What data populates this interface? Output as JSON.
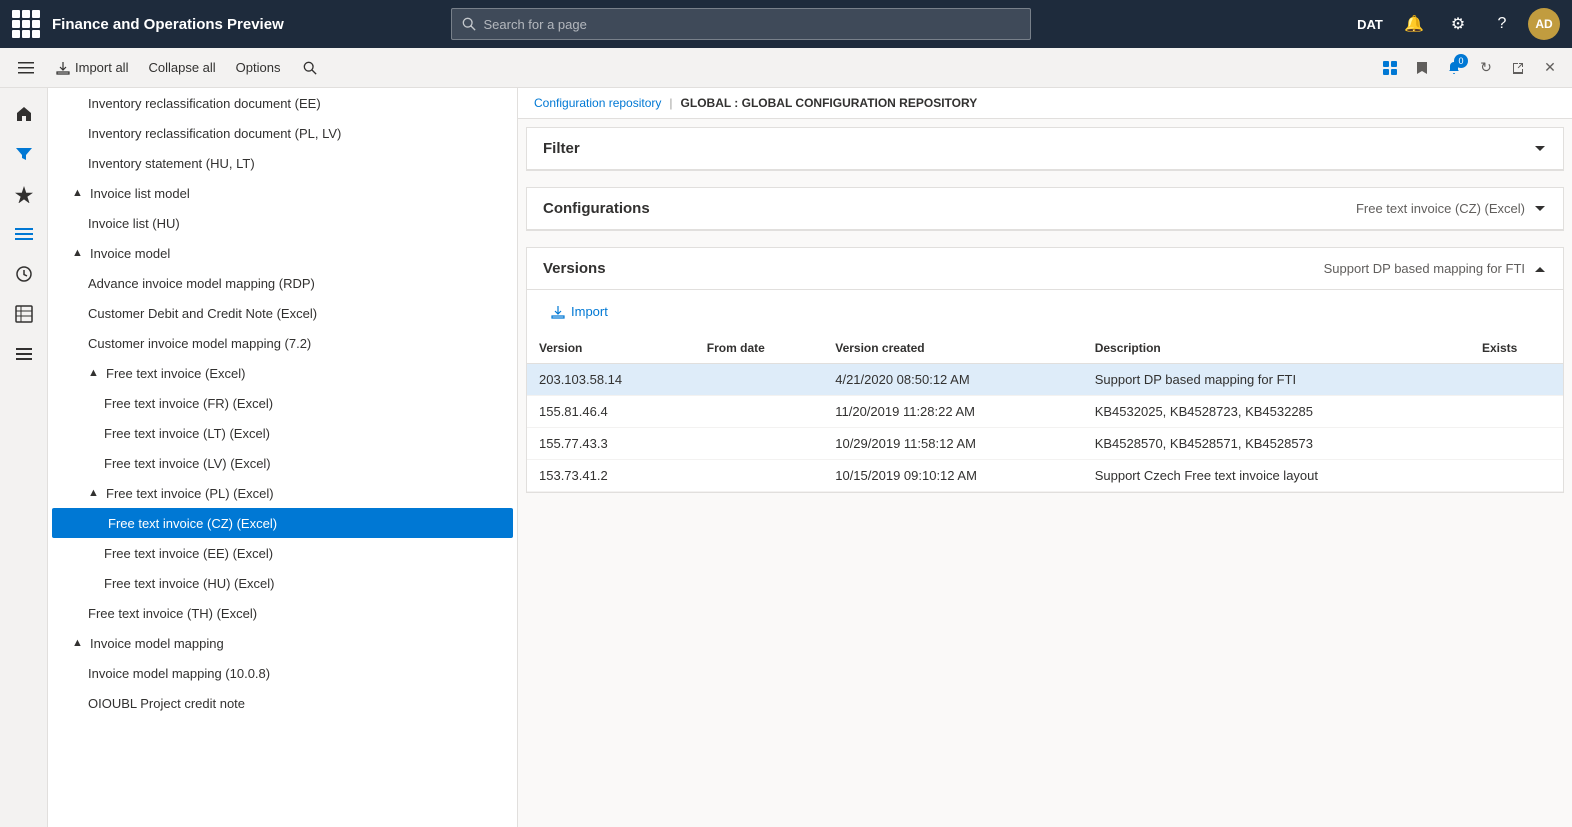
{
  "topbar": {
    "title": "Finance and Operations Preview",
    "search_placeholder": "Search for a page",
    "user_initials": "AD",
    "tenant": "DAT"
  },
  "subbar": {
    "import_all": "Import all",
    "collapse_all": "Collapse all",
    "options": "Options"
  },
  "breadcrumb": {
    "item1": "Configuration repository",
    "separator": "|",
    "item2": "GLOBAL : GLOBAL CONFIGURATION REPOSITORY"
  },
  "filter_section": {
    "title": "Filter",
    "collapsed": true
  },
  "configurations_section": {
    "title": "Configurations",
    "selected_value": "Free text invoice (CZ) (Excel)"
  },
  "versions_section": {
    "title": "Versions",
    "selected_value": "Support DP based mapping for FTI",
    "import_label": "Import",
    "columns": [
      "Version",
      "From date",
      "Version created",
      "Description",
      "Exists"
    ],
    "rows": [
      {
        "version": "203.103.58.14",
        "from_date": "",
        "version_created": "4/21/2020 08:50:12 AM",
        "description": "Support DP based mapping for FTI",
        "exists": "",
        "selected": true
      },
      {
        "version": "155.81.46.4",
        "from_date": "",
        "version_created": "11/20/2019 11:28:22 AM",
        "description": "KB4532025, KB4528723, KB4532285",
        "exists": "",
        "selected": false
      },
      {
        "version": "155.77.43.3",
        "from_date": "",
        "version_created": "10/29/2019 11:58:12 AM",
        "description": "KB4528570, KB4528571, KB4528573",
        "exists": "",
        "selected": false
      },
      {
        "version": "153.73.41.2",
        "from_date": "",
        "version_created": "10/15/2019 09:10:12 AM",
        "description": "Support Czech Free text invoice layout",
        "exists": "",
        "selected": false
      }
    ]
  },
  "tree": {
    "items": [
      {
        "label": "Inventory reclassification document (EE)",
        "level": 2,
        "type": "leaf"
      },
      {
        "label": "Inventory reclassification document (PL, LV)",
        "level": 2,
        "type": "leaf"
      },
      {
        "label": "Inventory statement (HU, LT)",
        "level": 2,
        "type": "leaf"
      },
      {
        "label": "Invoice list model",
        "level": 1,
        "type": "parent",
        "expanded": true
      },
      {
        "label": "Invoice list (HU)",
        "level": 2,
        "type": "leaf"
      },
      {
        "label": "Invoice model",
        "level": 1,
        "type": "parent",
        "expanded": true
      },
      {
        "label": "Advance invoice model mapping (RDP)",
        "level": 2,
        "type": "leaf"
      },
      {
        "label": "Customer Debit and Credit Note (Excel)",
        "level": 2,
        "type": "leaf"
      },
      {
        "label": "Customer invoice model mapping (7.2)",
        "level": 2,
        "type": "leaf"
      },
      {
        "label": "Free text invoice (Excel)",
        "level": 2,
        "type": "parent",
        "expanded": true
      },
      {
        "label": "Free text invoice (FR) (Excel)",
        "level": 3,
        "type": "leaf"
      },
      {
        "label": "Free text invoice (LT) (Excel)",
        "level": 3,
        "type": "leaf"
      },
      {
        "label": "Free text invoice (LV) (Excel)",
        "level": 3,
        "type": "leaf"
      },
      {
        "label": "Free text invoice (PL) (Excel)",
        "level": 2,
        "type": "parent",
        "expanded": true
      },
      {
        "label": "Free text invoice (CZ) (Excel)",
        "level": 3,
        "type": "leaf",
        "selected": true
      },
      {
        "label": "Free text invoice (EE) (Excel)",
        "level": 3,
        "type": "leaf"
      },
      {
        "label": "Free text invoice (HU) (Excel)",
        "level": 3,
        "type": "leaf"
      },
      {
        "label": "Free text invoice (TH) (Excel)",
        "level": 2,
        "type": "leaf"
      },
      {
        "label": "Invoice model mapping",
        "level": 1,
        "type": "parent",
        "expanded": true
      },
      {
        "label": "Invoice model mapping (10.0.8)",
        "level": 2,
        "type": "leaf"
      },
      {
        "label": "OIOUBL Project credit note",
        "level": 2,
        "type": "leaf"
      }
    ]
  }
}
